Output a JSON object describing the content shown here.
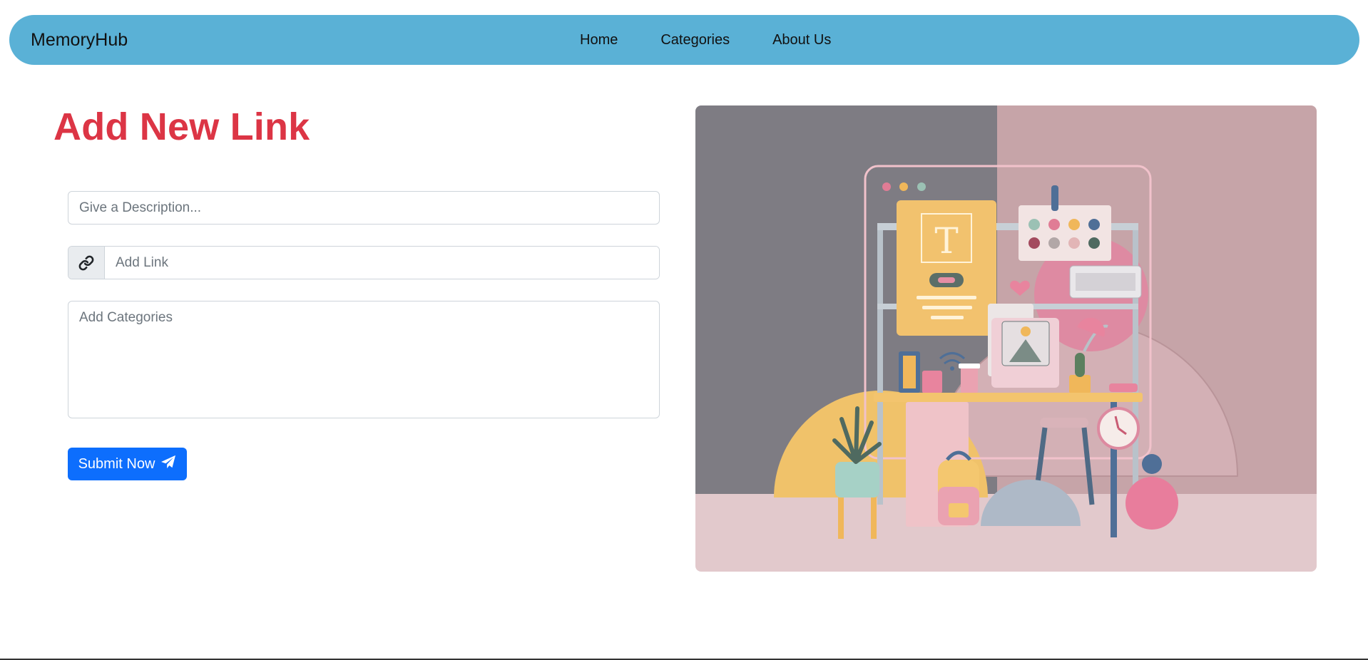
{
  "navbar": {
    "brand": "MemoryHub",
    "links": [
      {
        "label": "Home"
      },
      {
        "label": "Categories"
      },
      {
        "label": "About Us"
      }
    ],
    "background_color": "#5ab1d6"
  },
  "main": {
    "title": "Add New Link",
    "title_color": "#dc3545",
    "form": {
      "description": {
        "value": "",
        "placeholder": "Give a Description..."
      },
      "link": {
        "value": "",
        "placeholder": "Add Link",
        "addon_icon": "link-icon"
      },
      "categories": {
        "value": "",
        "placeholder": "Add Categories"
      },
      "submit": {
        "label": "Submit Now",
        "icon": "paper-plane-icon",
        "color": "#0d6efd"
      }
    },
    "hero_image": {
      "alt": "3D illustration of a creative workspace desk"
    }
  }
}
